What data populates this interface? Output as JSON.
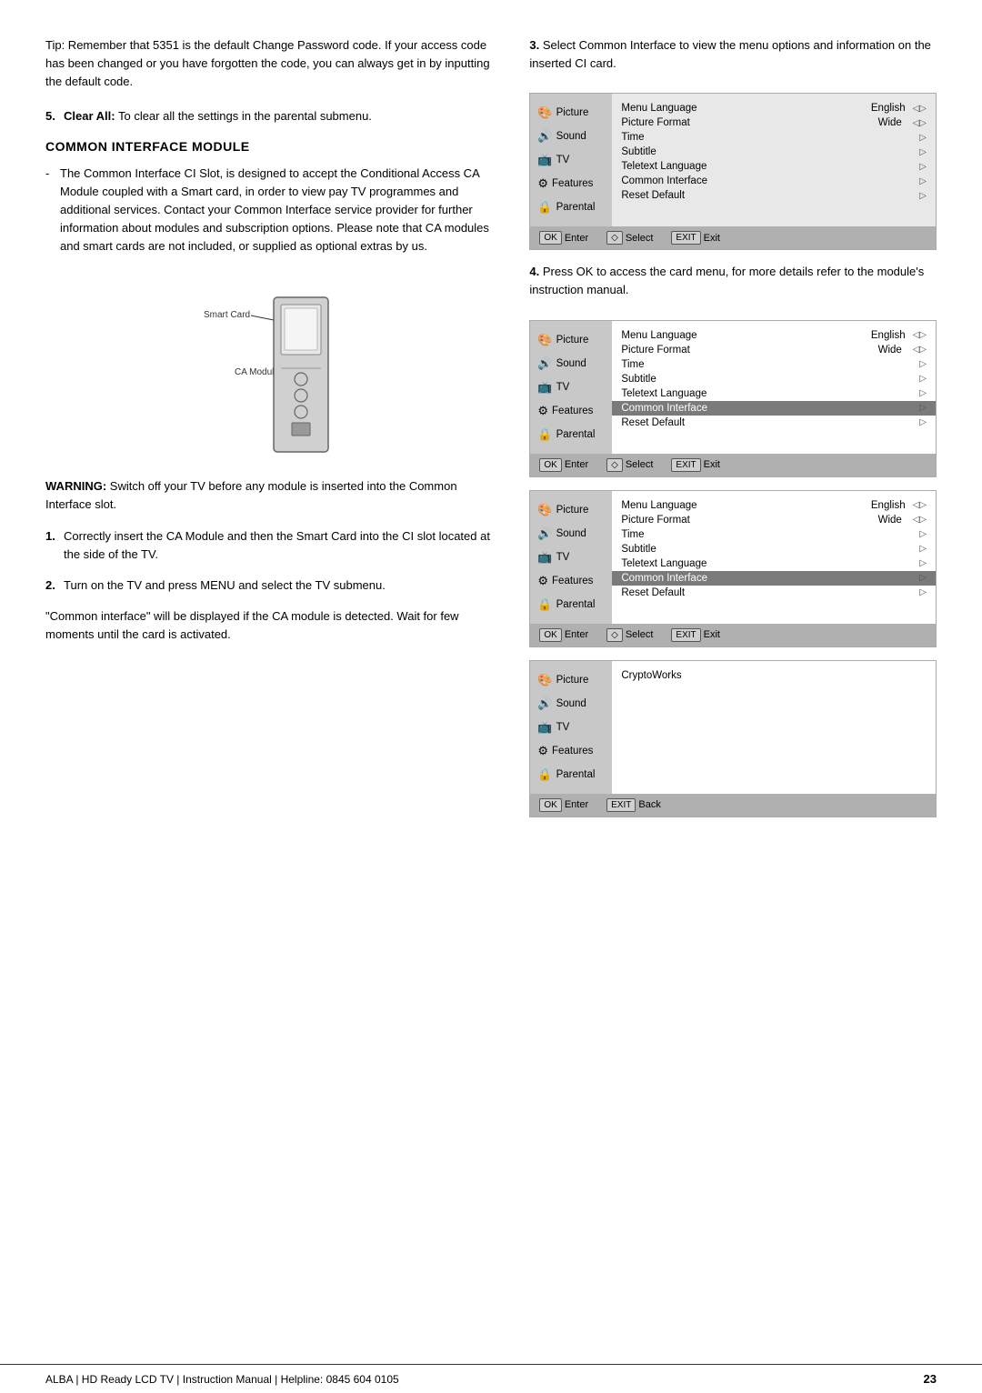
{
  "page": {
    "number": "23",
    "footer_text": "ALBA | HD Ready LCD TV | Instruction Manual | Helpline: 0845 604 0105"
  },
  "left_column": {
    "intro": {
      "text": "Tip: Remember that 5351 is the default Change Password code. If your access code has been changed or you have forgotten the code, you can always get in by inputting the default code."
    },
    "numbered_item_5": {
      "num": "5.",
      "label": "Clear All:",
      "text": " To clear all the settings in the parental submenu."
    },
    "section_heading": "COMMON INTERFACE MODULE",
    "bullet_text": "The Common Interface CI Slot, is designed to accept the Conditional Access CA Module coupled with a Smart card, in order to view pay TV programmes and additional services. Contact your Common Interface service provider for further information about modules and subscription options. Please note that CA modules and smart cards are not included, or supplied as optional extras by us.",
    "diagram": {
      "smart_card_label": "Smart Card",
      "ca_module_label": "CA Module"
    },
    "warning": {
      "label": "WARNING:",
      "text": " Switch off your TV before any module is inserted into the Common Interface slot."
    },
    "step_1": {
      "num": "1.",
      "text": "Correctly insert the CA Module and then the Smart Card into the CI slot located at the side of the TV."
    },
    "step_2": {
      "num": "2.",
      "text": "Turn on the TV and press MENU and select the TV submenu."
    },
    "quote_text": "\"Common interface\" will be displayed if the CA module is detected. Wait for few moments until the card is activated."
  },
  "right_column": {
    "step_3": {
      "num": "3.",
      "text": "Select Common Interface to view the menu options and information on the inserted CI card."
    },
    "step_4": {
      "num": "4.",
      "text": "Press OK to access the card menu, for more details refer to the module's instruction manual."
    },
    "menu_items_left": [
      {
        "icon": "🎨",
        "label": "Picture"
      },
      {
        "icon": "🔊",
        "label": "Sound"
      },
      {
        "icon": "📺",
        "label": "TV"
      },
      {
        "icon": "⚙",
        "label": "Features"
      },
      {
        "icon": "🔒",
        "label": "Parental"
      }
    ],
    "menu_rows_normal": [
      {
        "label": "Menu Language",
        "value": "English",
        "arrow": true
      },
      {
        "label": "Picture Format",
        "value": "Wide",
        "arrow": true
      },
      {
        "label": "Time",
        "value": "",
        "arrow": true
      },
      {
        "label": "Subtitle",
        "value": "",
        "arrow": true
      },
      {
        "label": "Teletext Language",
        "value": "",
        "arrow": true
      },
      {
        "label": "Common Interface",
        "value": "",
        "arrow": true,
        "highlighted": false
      },
      {
        "label": "Reset Default",
        "value": "",
        "arrow": true
      }
    ],
    "menu_rows_highlighted_ci": [
      {
        "label": "Menu Language",
        "value": "English",
        "arrow": true
      },
      {
        "label": "Picture Format",
        "value": "Wide",
        "arrow": true
      },
      {
        "label": "Time",
        "value": "",
        "arrow": true
      },
      {
        "label": "Subtitle",
        "value": "",
        "arrow": true
      },
      {
        "label": "Teletext Language",
        "value": "",
        "arrow": true
      },
      {
        "label": "Common Interface",
        "value": "",
        "arrow": true,
        "highlighted": true
      },
      {
        "label": "Reset Default",
        "value": "",
        "arrow": true
      }
    ],
    "footer_items": [
      {
        "key": "OK",
        "label": "Enter"
      },
      {
        "key": "◇",
        "label": "Select"
      },
      {
        "key": "EXIT",
        "label": "Exit"
      }
    ],
    "footer_items_back": [
      {
        "key": "OK",
        "label": "Enter"
      },
      {
        "key": "EXIT",
        "label": "Back"
      }
    ],
    "cryptoworks_label": "CryptoWorks"
  }
}
